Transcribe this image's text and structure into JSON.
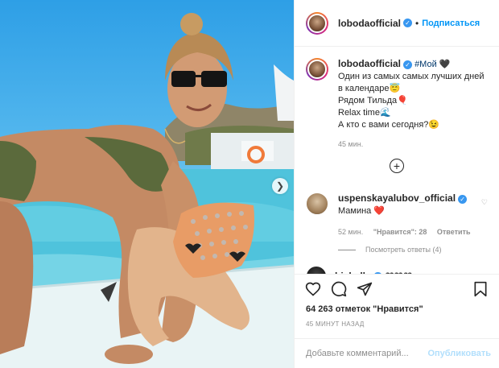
{
  "header": {
    "username": "lobodaofficial",
    "separator": "•",
    "follow_label": "Подписаться"
  },
  "caption": {
    "username": "lobodaofficial",
    "hashtag": "#Мой",
    "emoji_heart": "🖤",
    "line1": "Один из самых самых лучших дней в календаре",
    "emoji1": "😇",
    "line2": "Рядом Тильда",
    "emoji2": "🎈",
    "line3": "Relax time",
    "emoji3": "🌊",
    "line4": "А кто с вами сегодня?",
    "emoji4": "😉",
    "time": "45 мин."
  },
  "comment": {
    "username": "uspenskayalubov_official",
    "text": "Мамина",
    "emoji": "❤️",
    "time": "52 мин.",
    "likes": "\"Нравится\": 28",
    "reply_label": "Ответить",
    "view_replies": "Посмотреть ответы (4)"
  },
  "next_comment": {
    "username": "bichella",
    "emoji": "🖤🖤🖤"
  },
  "post": {
    "likes": "64 263 отметок \"Нравится\"",
    "time": "45 МИНУТ НАЗАД"
  },
  "add_comment": {
    "placeholder": "Добавьте комментарий...",
    "publish_label": "Опубликовать"
  },
  "icons": {
    "verified": "verified-badge-icon",
    "like": "heart-icon",
    "comment": "comment-icon",
    "share": "share-icon",
    "save": "bookmark-icon",
    "load_more": "plus-circle-icon",
    "next": "chevron-right-icon"
  },
  "colors": {
    "link_blue": "#0095f6",
    "verified_blue": "#3897f0",
    "publish_disabled": "#b2dffc",
    "muted": "#8e8e8e"
  }
}
